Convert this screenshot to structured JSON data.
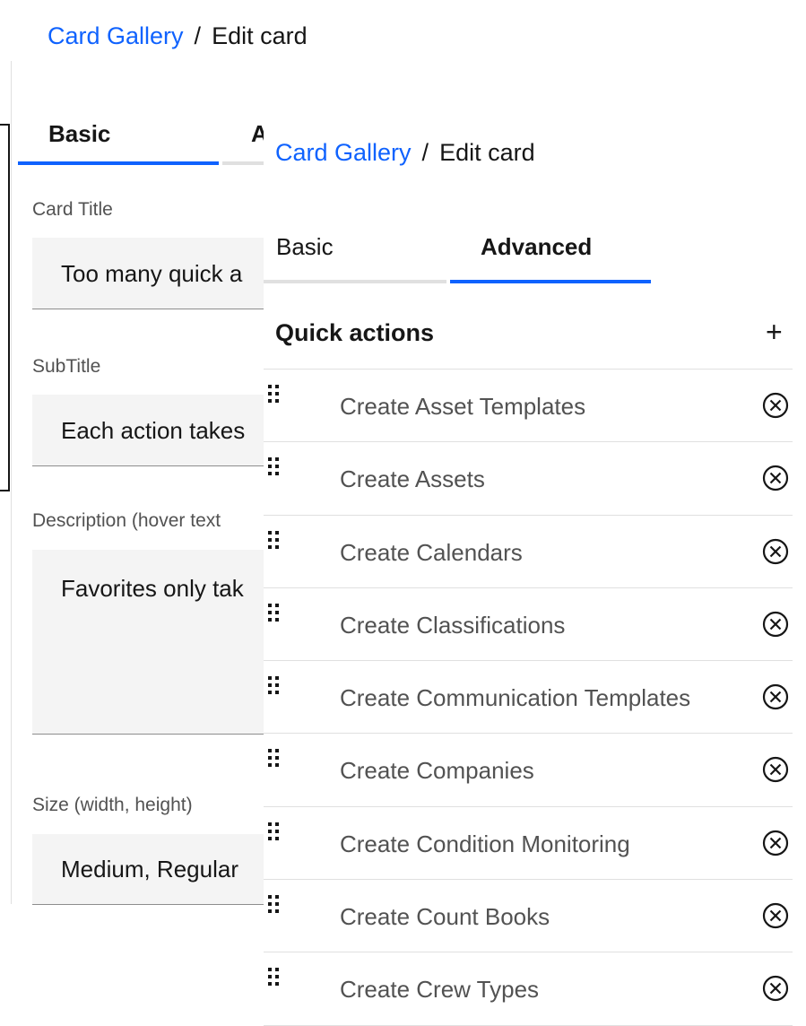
{
  "background_panel": {
    "breadcrumb": {
      "link": "Card Gallery",
      "separator": "/",
      "current": "Edit card"
    },
    "tabs": {
      "basic": "Basic",
      "advanced": "A"
    },
    "fields": {
      "card_title": {
        "label": "Card Title",
        "value": "Too many quick a"
      },
      "subtitle": {
        "label": "SubTitle",
        "value": "Each action takes"
      },
      "description": {
        "label": "Description (hover text",
        "value": "Favorites only tak"
      },
      "size": {
        "label": "Size (width, height)",
        "value": "Medium, Regular"
      }
    }
  },
  "front_panel": {
    "breadcrumb": {
      "link": "Card Gallery",
      "separator": "/",
      "current": "Edit card"
    },
    "tabs": {
      "basic": "Basic",
      "advanced": "Advanced",
      "active": "Advanced"
    },
    "quick_actions": {
      "title": "Quick actions",
      "add_icon": "+",
      "items": [
        {
          "label": "Create Asset Templates"
        },
        {
          "label": "Create Assets"
        },
        {
          "label": "Create Calendars"
        },
        {
          "label": "Create Classifications"
        },
        {
          "label": "Create Communication Templates"
        },
        {
          "label": "Create Companies"
        },
        {
          "label": "Create Condition Monitoring"
        },
        {
          "label": "Create Count Books"
        },
        {
          "label": "Create Crew Types"
        }
      ]
    }
  },
  "colors": {
    "link": "#0f62fe",
    "tab_active": "#0f62fe",
    "field_bg": "#f4f4f4",
    "divider": "#e0e0e0"
  },
  "icons": {
    "drag": "drag-handle-icon",
    "remove": "close-outline-icon",
    "add": "add-icon"
  }
}
